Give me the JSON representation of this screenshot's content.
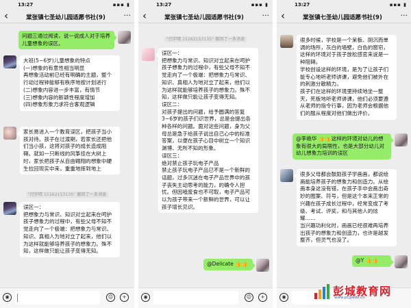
{
  "status": {
    "time": "13:27",
    "signal": "▪▪▪ ▮"
  },
  "chat": {
    "title": "棠张镇七圣幼儿园适愿书社(9)",
    "back_glyph": "‹",
    "more_glyph": "···"
  },
  "panel1": {
    "messages": [
      {
        "text": "问题三通过阅读，说一说成人对于培养儿童想象的误区。"
      },
      {
        "text": "大班(5~6岁)儿童想象的特点\n(一)想象的有意性相当明显\n再想象活动前已经有明确的主题，整个行动过程钟能够有秩序地按计划进行\n(二)想象内容进一步丰富，有情节\n(三)想象内容的新颖性程度增加\n(四)想象形象力求符合客观逻辑"
      },
      {
        "text": "家长易进入一个教育误区，把孩子当小孩对待。孩子在过渡期，若家长还把他们当小孩，这将对孩子的成长造成阻碍。就如一只断线的风筝挂在大树上时，家长把孩子从自由翱翔的想象中硬生拉回现实中来，重重地摔到地上"
      },
      {
        "text": "误区一：\n把想象力与常识、知识对立起来在呵护孩子想象力的过程中，有些父母不知不觉走向了一个极端：把想象力与常识、知识、真相人为地对立了起来，他们以为这样就能够培养孩子的想象力。殊不知，这样做只能让孩子变得无知。"
      }
    ],
    "recall_note": "\"闫宇晴 15162153135\" 撤回了一条消息"
  },
  "panel2": {
    "recall_note": "\"闫宇晴 15162153135\" 撤回了一条消息",
    "messages": [
      {
        "text": "误区一：\n把想象力与常识、知识对立起来在呵护孩子想象力的过程中，有些父母不知不觉走向了一个极端：把想象力与常识、知识、真相人为地对立了起来，他们以为这样就能够培养孩子的想象力。殊不知，这样做只能让孩子变得无知。\n误区二：\n对孩子提出的问题，给予圆满的答复\n3~6岁的孩子们识世界，总是会提出各种各样的问题。面对这些问题，身为父母总是急于给孩子说出自己心中的标准答案，以便在孩子心目中树立一个知识渊博、无所不知的形象。\n误区三：\n绝对禁止孩子玩电子产品\n禁止孩子玩电子产品已不是一个新鲜的话题，过多沉迷在电子产品世界中的孩子丧失主动思考的能力，的确令人担忧。但因噎废食也不可取，电子产品可以为孩子带来一个新鲜的世界，可以让孩子增长见识。"
      },
      {
        "text": "@Delicate 👍👍"
      }
    ]
  },
  "panel3": {
    "messages": [
      {
        "text": "很多时候，学校是一个呆板、阴沉而单调的场所，灰白的墙壁，白色的窗帘，这样的环境对于孩子放松感官来说是一种阻碍。\n学校创设这样的环境，是为了让孩子们能专心地听老师讲课，避免他们被外在的刺激分散精力。\n孩子们在这样的环境里持续地坐一整天，死板地听老师讲课，他们必须要遵从老师的指令行事，因为老师会根据他们的服从程度对他们做出评价。"
      },
      {
        "text": "@李艳华 👍👍这样的环境对幼儿的想象有很大的局限性，也是大部分幼儿对幼儿想象力培训的误区"
      },
      {
        "text": "很多父母都会鼓励孩子学画画，都说绘画能培养孩子的想象力和创造力。从绘画本身这没有错，在孩子手中会画出奇妙的图案、符号，但是这个本来正常的兴趣在孩子成长过程中，经常变成了考级、考试、评奖，和与其他人的炫耀……\n当兴趣功利化时，画画已经很难再培养出孩子的想象力和创造力，也许是越发整齐，但灵气也没了。"
      },
      {
        "text": "@Y 👍👍"
      }
    ],
    "watermark": {
      "name": "彭城教育网",
      "url": "www.pcjyedu.cn"
    }
  },
  "colors": {
    "green_bubble": "#95ec69",
    "bg": "#ededed",
    "watermark_red": "#d8212a"
  }
}
